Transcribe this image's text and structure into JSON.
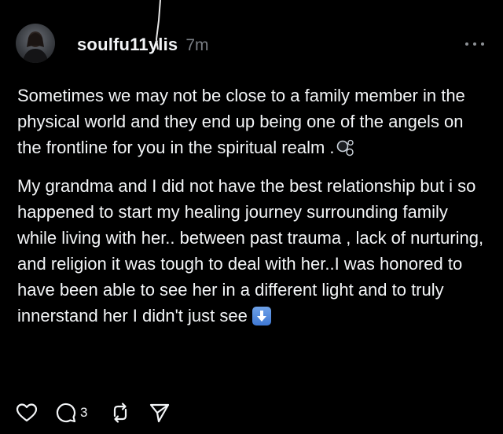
{
  "post": {
    "username": "soulfu11ylis",
    "timestamp": "7m",
    "paragraphs": [
      "Sometimes we may not be close to a family member in the physical world and they end up being one of the angels on the frontline for you in the spiritual realm .",
      "My grandma and I did not have the best relationship but i so happened to start my healing journey surrounding family while living with her.. between past trauma , lack of nurturing, and religion it was tough to deal with her..I was honored to have been able to see her in a different light and to truly innerstand her I didn't just see"
    ],
    "emojis": {
      "p1_end": "bubbles-emoji",
      "p2_end": "down-arrow-emoji"
    }
  },
  "actions": {
    "like_icon": "heart-icon",
    "comment_icon": "comment-icon",
    "comment_count": "3",
    "repost_icon": "repost-icon",
    "share_icon": "send-icon"
  },
  "colors": {
    "background": "#000000",
    "text": "#f3f5f7",
    "muted": "#7b7f85"
  }
}
